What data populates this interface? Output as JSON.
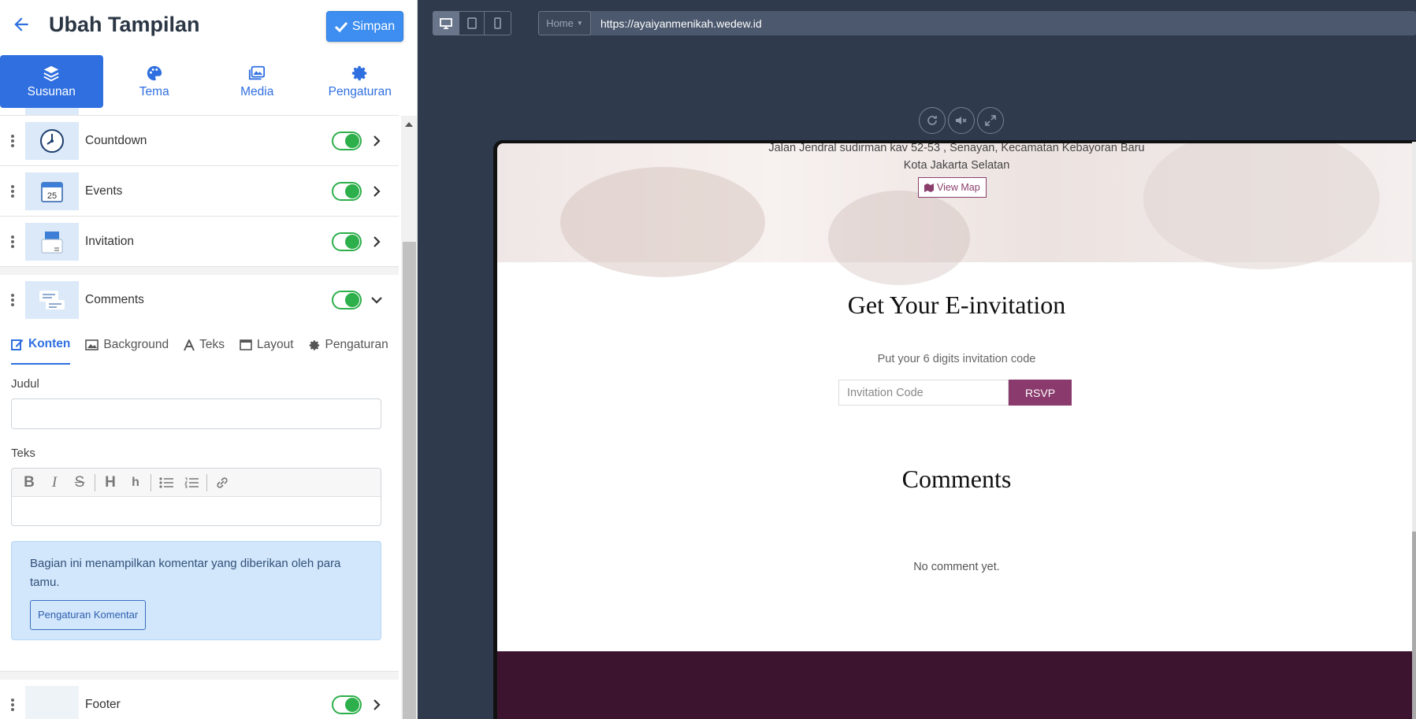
{
  "header": {
    "title": "Ubah Tampilan",
    "save_label": "Simpan"
  },
  "main_tabs": [
    {
      "label": "Susunan",
      "icon": "layers-icon",
      "active": true
    },
    {
      "label": "Tema",
      "icon": "palette-icon",
      "active": false
    },
    {
      "label": "Media",
      "icon": "images-icon",
      "active": false
    },
    {
      "label": "Pengaturan",
      "icon": "gear-icon",
      "active": false
    }
  ],
  "sections": [
    {
      "label": "Countdown",
      "icon": "clock-icon",
      "enabled": true
    },
    {
      "label": "Events",
      "icon": "calendar-icon",
      "enabled": true
    },
    {
      "label": "Invitation",
      "icon": "invitation-icon",
      "enabled": true
    },
    {
      "label": "Comments",
      "icon": "comments-icon",
      "enabled": true,
      "expanded": true
    },
    {
      "label": "Footer",
      "icon": "footer-icon",
      "enabled": true
    }
  ],
  "comments_editor": {
    "subtabs": [
      {
        "label": "Konten",
        "icon": "edit-icon",
        "active": true
      },
      {
        "label": "Background",
        "icon": "image-icon",
        "active": false
      },
      {
        "label": "Teks",
        "icon": "font-icon",
        "active": false
      },
      {
        "label": "Layout",
        "icon": "window-icon",
        "active": false
      },
      {
        "label": "Pengaturan",
        "icon": "gear-icon",
        "active": false
      }
    ],
    "judul_label": "Judul",
    "judul_value": "",
    "teks_label": "Teks",
    "toolbar": [
      "bold-icon",
      "italic-icon",
      "strikethrough-icon",
      "heading-icon",
      "heading-small-icon",
      "bullet-list-icon",
      "numbered-list-icon",
      "link-icon"
    ],
    "info_text": "Bagian ini menampilkan komentar yang diberikan oleh para tamu.",
    "info_button": "Pengaturan Komentar"
  },
  "preview": {
    "page_select": "Home",
    "url": "https://ayaiyanmenikah.wedew.id",
    "address_line1": "Jalan Jendral sudirman kav 52-53 , Senayan, Kecamatan Kebayoran Baru",
    "address_line2": "Kota Jakarta Selatan",
    "view_map": "View Map",
    "einvite_title": "Get Your E-invitation",
    "einvite_hint": "Put your 6 digits invitation code",
    "code_placeholder": "Invitation Code",
    "rsvp_label": "RSVP",
    "comments_title": "Comments",
    "no_comment": "No comment yet.",
    "accent_color": "#8a3a6c",
    "footer_color": "#3d1430"
  },
  "colors": {
    "primary": "#2f6fe0",
    "toggle_on": "#2daf4b"
  }
}
